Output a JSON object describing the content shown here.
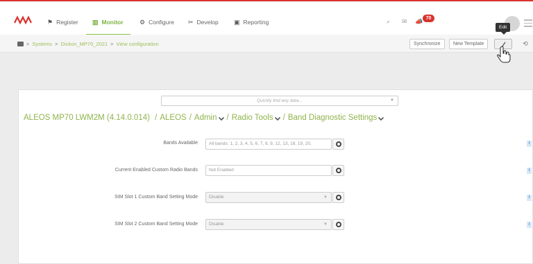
{
  "colors": {
    "brand_red": "#d9332e",
    "accent_green": "#8bc34a",
    "info_blue": "#4a88c7"
  },
  "nav": {
    "items": [
      {
        "label": "Register",
        "icon": "flag-icon"
      },
      {
        "label": "Monitor",
        "icon": "monitor-icon",
        "active": true
      },
      {
        "label": "Configure",
        "icon": "gear-icon"
      },
      {
        "label": "Develop",
        "icon": "tools-icon"
      },
      {
        "label": "Reporting",
        "icon": "report-icon"
      }
    ],
    "notifications_count": "70",
    "tooltip": "Edit"
  },
  "subbar": {
    "breadcrumb": [
      "Systems",
      "Dickon_MP70_2021",
      "View configuration"
    ],
    "synchronize_label": "Synchronize",
    "new_template_label": "New Template"
  },
  "main": {
    "search_placeholder": "Quickly find any data...",
    "path": {
      "root": "ALEOS MP70 LWM2M (4.14.0.014)",
      "items": [
        "ALEOS",
        "Admin",
        "Radio Tools",
        "Band Diagnostic Settings"
      ]
    },
    "rows": [
      {
        "label": "Bands Available",
        "value": "All bands: 1, 2, 3, 4, 5, 6, 7, 8, 9, 12, 13, 18, 19, 20,"
      },
      {
        "label": "Current Enabled Custom Radio Bands",
        "value": "Not Enabled"
      },
      {
        "label": "SIM Slot 1 Custom Band Setting Mode",
        "value": "Disable"
      },
      {
        "label": "SIM Slot 2 Custom Band Setting Mode",
        "value": "Disable"
      }
    ],
    "info_label": "i"
  }
}
